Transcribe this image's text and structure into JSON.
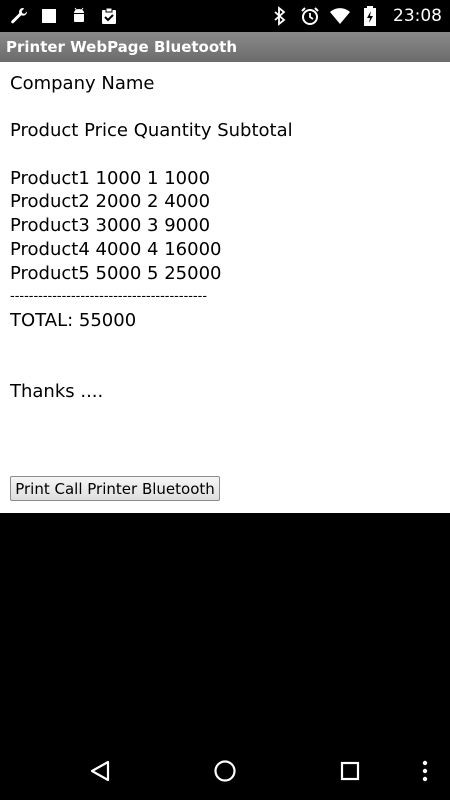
{
  "status_bar": {
    "left_icons": [
      "wrench-icon",
      "square-icon",
      "android-icon",
      "clipboard-check-icon"
    ],
    "right_icons": [
      "bluetooth-icon",
      "alarm-icon",
      "wifi-icon",
      "battery-icon"
    ],
    "time": "23:08"
  },
  "app": {
    "title": "Printer WebPage Bluetooth"
  },
  "receipt": {
    "company": "Company Name",
    "header": "Product Price Quantity Subtotal",
    "rows": [
      "Product1 1000 1 1000",
      "Product2 2000 2 4000",
      "Product3 3000 3 9000",
      "Product4 4000 4 16000",
      "Product5 5000 5 25000"
    ],
    "separator": "------------------------------------------",
    "total": "TOTAL: 55000",
    "thanks": "Thanks ...."
  },
  "print_button_label": "Print Call Printer Bluetooth",
  "nav_bar": {
    "buttons": [
      "back-icon",
      "home-icon",
      "recents-icon",
      "overflow-menu-icon"
    ]
  }
}
